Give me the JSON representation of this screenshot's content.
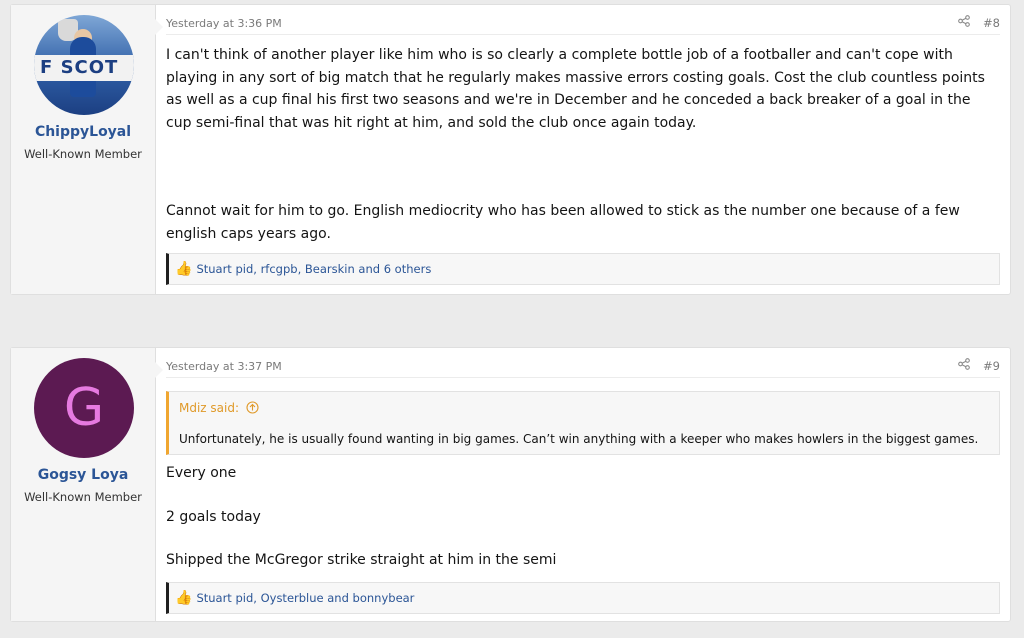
{
  "posts": [
    {
      "user": {
        "name": "ChippyLoyal",
        "title": "Well-Known Member",
        "avatar_text": "F SCOT"
      },
      "date": "Yesterday at 3:36 PM",
      "share_icon": "share-icon",
      "number": "#8",
      "paragraphs": [
        "I can't think of another player like him who is so clearly a complete bottle job of a footballer and can't cope with playing in any sort of big match that he regularly makes massive errors costing goals. Cost the club countless points as well as a cup final his first two seasons and we're in December and he conceded a back breaker of a goal in the cup semi-final that was hit right at him, and sold the club once again today.",
        "Cannot wait for him to go. English mediocrity who has been allowed to stick as the number one because of a few english caps years ago."
      ],
      "reactions": "Stuart pid, rfcgpb, Bearskin and 6 others"
    },
    {
      "user": {
        "name": "Gogsy Loya",
        "title": "Well-Known Member",
        "avatar_letter": "G"
      },
      "date": "Yesterday at 3:37 PM",
      "share_icon": "share-icon",
      "number": "#9",
      "quote": {
        "author": "Mdiz said:",
        "text": "Unfortunately, he is usually found wanting in big games. Can’t win anything with a keeper who makes howlers in the biggest games."
      },
      "paragraphs": [
        "Every one",
        "2 goals today",
        "Shipped the McGregor strike straight at him in the semi"
      ],
      "reactions": "Stuart pid, Oysterblue and bonnybear"
    }
  ],
  "colors": {
    "link": "#2b5596",
    "quote_accent": "#f0a630",
    "avatar_g_bg": "#5c1a52",
    "avatar_g_fg": "#e67ae0"
  }
}
